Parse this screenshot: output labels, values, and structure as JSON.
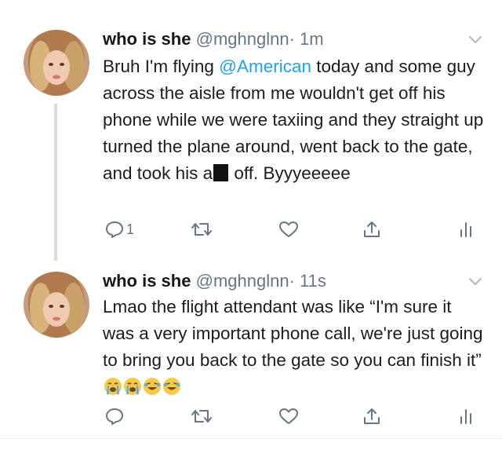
{
  "tweets": [
    {
      "author_name": "who is she",
      "handle": "@mghnglnn",
      "separator": "·",
      "time": "1m",
      "body_parts": {
        "p1": "Bruh I'm flying ",
        "mention": "@American",
        "p2": " today and some guy across the aisle from me wouldn't get off his phone while we were taxiing and they straight up turned the plane around, went back to the gate, and took his a",
        "p3": " off. Byyyeeeee"
      },
      "reply_count": "1",
      "icons": [
        "reply-icon",
        "retweet-icon",
        "like-icon",
        "share-icon",
        "analytics-icon"
      ]
    },
    {
      "author_name": "who is she",
      "handle": "@mghnglnn",
      "separator": "·",
      "time": "11s",
      "body_text": "Lmao the flight attendant was like “I'm sure it was a very important phone call, we're just going to bring you back to the gate so you can finish it” ",
      "emojis": [
        "weeping-emoji",
        "weeping-emoji",
        "laughing-emoji",
        "laughing-emoji"
      ],
      "reply_count": "",
      "icons": [
        "reply-icon",
        "retweet-icon",
        "like-icon",
        "share-icon",
        "analytics-icon"
      ]
    }
  ],
  "colors": {
    "mention": "#1da1f2",
    "icon_gray": "#657786",
    "thread_line": "#d6dce1"
  }
}
